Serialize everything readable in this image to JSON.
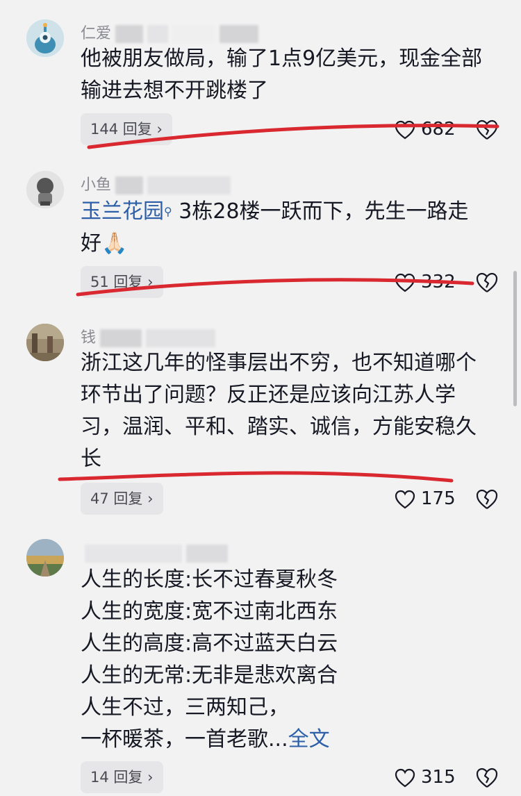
{
  "comments": [
    {
      "username": "仁爱",
      "lines": [
        "他被朋友做局，输了1点9亿美元，现金全部",
        "输进去想不开跳楼了"
      ],
      "replies": "144 回复",
      "likes": "682"
    },
    {
      "username": "小鱼",
      "link": "玉兰花园",
      "lines": [
        "3栋28楼一跃而下，先生一路走",
        "好🙏🏻"
      ],
      "replies": "51 回复",
      "likes": "332"
    },
    {
      "username": "钱",
      "lines": [
        "浙江这几年的怪事层出不穷，也不知道哪个",
        "环节出了问题？反正还是应该向江苏人学",
        "习，温润、平和、踏实、诚信，方能安稳久",
        "长"
      ],
      "replies": "47 回复",
      "likes": "175"
    },
    {
      "username": "",
      "lines": [
        "人生的长度:长不过春夏秋冬",
        "人生的宽度:宽不过南北西东",
        "人生的高度:高不过蓝天白云",
        "人生的无常:无非是悲欢离合",
        "人生不过，三两知己，",
        "一杯暖茶，一首老歌..."
      ],
      "more": "全文",
      "replies": "14 回复",
      "likes": "315"
    }
  ],
  "colors": {
    "background": "#f2f2f2",
    "text": "#161823",
    "link": "#2d5fa8",
    "annotation": "#d9282f"
  },
  "icons": [
    "heart-icon",
    "broken-heart-icon",
    "chevron-right-icon",
    "search-icon"
  ]
}
